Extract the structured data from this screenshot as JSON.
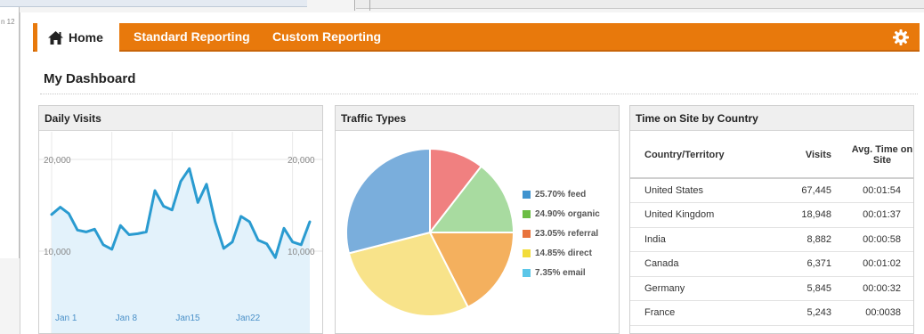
{
  "background": {
    "tab_fragment": "n 12"
  },
  "nav": {
    "home_label": "Home",
    "home_icon": "home-icon",
    "items": [
      {
        "label": "Standard Reporting"
      },
      {
        "label": "Custom Reporting"
      }
    ],
    "settings_icon": "gear-icon",
    "accent_color": "#e8790c"
  },
  "page": {
    "title": "My Dashboard"
  },
  "daily_visits": {
    "title": "Daily Visits",
    "y_left_labels": [
      "20,000",
      "10,000"
    ],
    "y_right_labels": [
      "20,000",
      "10,000"
    ],
    "line_color": "#2a9bd0",
    "fill_color": "#e3f2fb",
    "chart_data": {
      "type": "area",
      "x": [
        "Jan 1",
        "Jan 2",
        "Jan 3",
        "Jan 4",
        "Jan 5",
        "Jan 6",
        "Jan 7",
        "Jan 8",
        "Jan 9",
        "Jan 10",
        "Jan 11",
        "Jan 12",
        "Jan 13",
        "Jan 14",
        "Jan 15",
        "Jan 16",
        "Jan 17",
        "Jan 18",
        "Jan 19",
        "Jan 20",
        "Jan 21",
        "Jan 22",
        "Jan 23",
        "Jan 24",
        "Jan 25",
        "Jan 26",
        "Jan 27",
        "Jan 28",
        "Jan 29",
        "Jan 30",
        "Jan 31"
      ],
      "values": [
        14000,
        14800,
        14100,
        12300,
        12100,
        12400,
        10700,
        10200,
        12800,
        11800,
        11900,
        12100,
        16600,
        14900,
        14500,
        17600,
        19000,
        15300,
        17300,
        13200,
        10300,
        11000,
        13800,
        13200,
        11200,
        10800,
        9300,
        12500,
        11000,
        10700,
        13200
      ],
      "x_tick_labels": [
        "Jan 1",
        "Jan 8",
        "Jan15",
        "Jan22"
      ],
      "ylim": [
        0,
        20000
      ],
      "grid": true
    }
  },
  "traffic_types": {
    "title": "Traffic Types",
    "legend": [
      {
        "label": "25.70% feed",
        "color": "#3f93cf"
      },
      {
        "label": "24.90% organic",
        "color": "#6cbd45"
      },
      {
        "label": "23.05% referral",
        "color": "#e8733c"
      },
      {
        "label": "14.85% direct",
        "color": "#f2dc3a"
      },
      {
        "label": "7.35% email",
        "color": "#5bc6e8"
      }
    ],
    "chart_data": {
      "type": "pie",
      "slices": [
        {
          "value": 10.5,
          "color": "#f08080"
        },
        {
          "value": 14.5,
          "color": "#a8dba0"
        },
        {
          "value": 17.5,
          "color": "#f4b05e"
        },
        {
          "value": 28.5,
          "color": "#f8e38a"
        },
        {
          "value": 29.0,
          "color": "#7aaedc"
        }
      ]
    }
  },
  "time_on_site": {
    "title": "Time on Site by Country",
    "columns": {
      "country": "Country/Territory",
      "visits": "Visits",
      "avg": "Avg. Time on Site"
    },
    "rows": [
      {
        "country": "United States",
        "visits": "67,445",
        "avg": "00:01:54"
      },
      {
        "country": "United Kingdom",
        "visits": "18,948",
        "avg": "00:01:37"
      },
      {
        "country": "India",
        "visits": "8,882",
        "avg": "00:00:58"
      },
      {
        "country": "Canada",
        "visits": "6,371",
        "avg": "00:01:02"
      },
      {
        "country": "Germany",
        "visits": "5,845",
        "avg": "00:00:32"
      },
      {
        "country": "France",
        "visits": "5,243",
        "avg": "00:0038"
      }
    ]
  }
}
